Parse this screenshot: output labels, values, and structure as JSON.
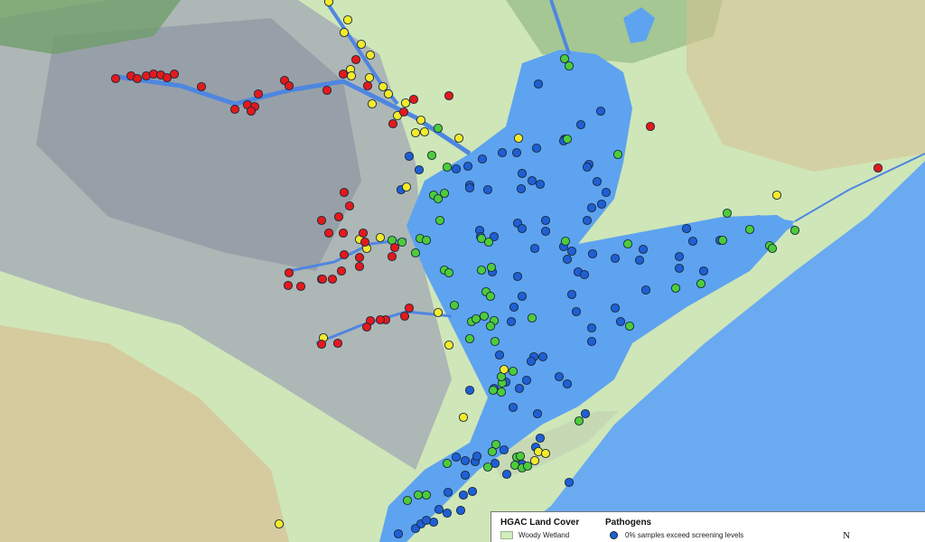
{
  "legend": {
    "land_cover_title": "HGAC Land Cover",
    "land_cover_item": "Woody Wetland",
    "land_cover_color": "#d4ecbd",
    "pathogens_title": "Pathogens",
    "pathogens_item": "0% samples exceed screening levels",
    "pathogens_item_color": "#1e5fd6",
    "north_label": "N"
  },
  "colors": {
    "water": "#5ea3f0",
    "gulf": "#6aaaf0",
    "land": "#cfe6b8",
    "urban": "#9fa8b0",
    "forest": "#6f9e6a",
    "agri": "#d9b98c",
    "river": "#4f86e0"
  },
  "site_categories": {
    "red": "#e3191c",
    "yellow": "#f4ea2c",
    "green": "#4ccc3a",
    "blue": "#1e5fd6"
  }
}
